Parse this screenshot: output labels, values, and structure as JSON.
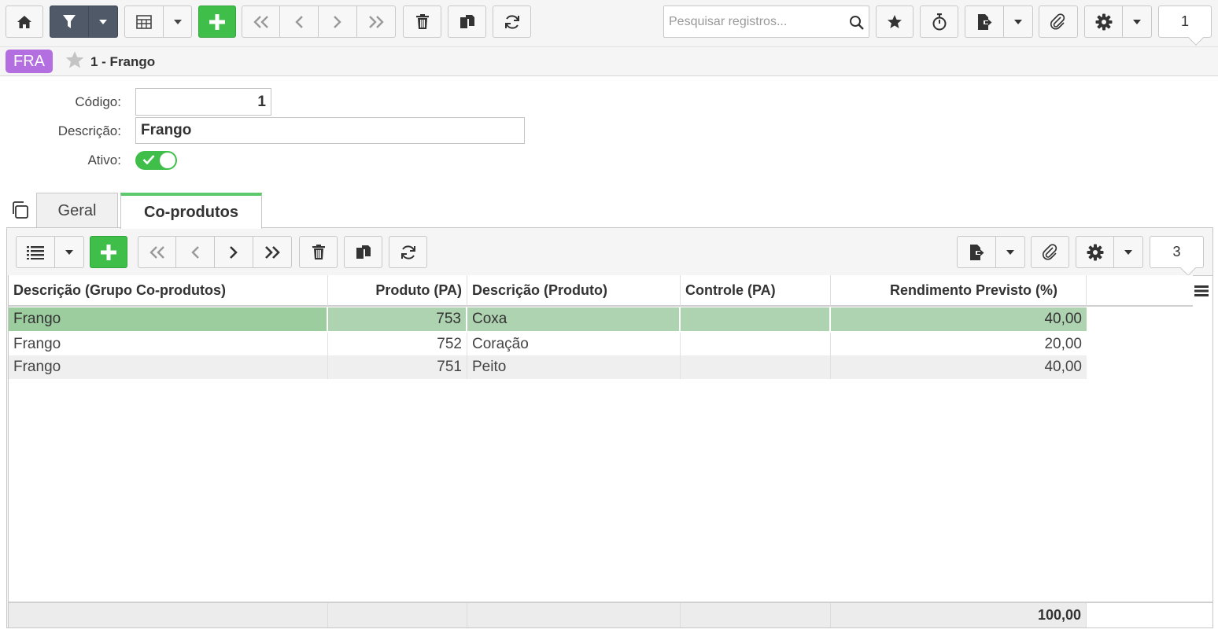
{
  "toolbar": {
    "search_placeholder": "Pesquisar registros...",
    "record_counter": "1"
  },
  "breadcrumb": {
    "badge": "FRA",
    "title": "1 - Frango"
  },
  "form": {
    "codigo_label": "Código:",
    "codigo_value": "1",
    "descricao_label": "Descrição:",
    "descricao_value": "Frango",
    "ativo_label": "Ativo:",
    "ativo_value": true
  },
  "tabs": [
    {
      "label": "Geral",
      "active": false
    },
    {
      "label": "Co-produtos",
      "active": true
    }
  ],
  "subtoolbar": {
    "record_counter": "3"
  },
  "grid": {
    "columns": [
      "Descrição (Grupo Co-produtos)",
      "Produto (PA)",
      "Descrição (Produto)",
      "Controle (PA)",
      "Rendimento Previsto (%)"
    ],
    "rows": [
      {
        "grupo": "Frango",
        "produto": "753",
        "descricao": "Coxa",
        "controle": "",
        "rendimento": "40,00"
      },
      {
        "grupo": "Frango",
        "produto": "752",
        "descricao": "Coração",
        "controle": "",
        "rendimento": "20,00"
      },
      {
        "grupo": "Frango",
        "produto": "751",
        "descricao": "Peito",
        "controle": "",
        "rendimento": "40,00"
      }
    ],
    "total_rendimento": "100,00"
  },
  "colors": {
    "accent_green": "#3fbf4a",
    "badge_purple": "#b36ee0",
    "selected_row": "#aed3b0",
    "filter_dark": "#4f5967"
  }
}
